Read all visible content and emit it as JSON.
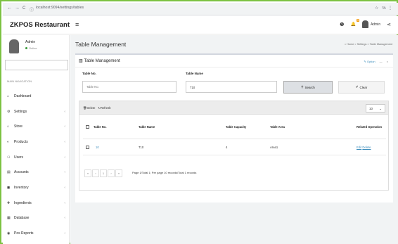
{
  "browser": {
    "back": "←",
    "forward": "→",
    "reload": "C",
    "info": "ⓘ",
    "url": "localhost:9094/settings/tables",
    "star": "☆",
    "ext": "℅",
    "menu": "⋮"
  },
  "header": {
    "brand": "ZKPOS Restaurant",
    "menu_toggle": "≡",
    "info_icon": "❶",
    "bell_icon": "🔔",
    "notification_count": "3",
    "user_label": "Admin",
    "share_icon": "⋖"
  },
  "sidebar": {
    "user_name": "Admin",
    "user_status": "Online",
    "search_placeholder": "",
    "section_label": "MAIN NAVIGATION",
    "items": [
      {
        "icon": "⌂",
        "label": "Dashboard",
        "chevron": ""
      },
      {
        "icon": "⚙",
        "label": "Settings",
        "chevron": "‹"
      },
      {
        "icon": "⌂",
        "label": "Store",
        "chevron": "‹"
      },
      {
        "icon": "◐",
        "label": "Products",
        "chevron": "‹"
      },
      {
        "icon": "⚇",
        "label": "Users",
        "chevron": "‹"
      },
      {
        "icon": "▤",
        "label": "Accounts",
        "chevron": "‹"
      },
      {
        "icon": "◼",
        "label": "Inventory",
        "chevron": "‹"
      },
      {
        "icon": "✚",
        "label": "Ingredients",
        "chevron": "‹"
      },
      {
        "icon": "▦",
        "label": "Database",
        "chevron": "‹"
      },
      {
        "icon": "◉",
        "label": "Pos Reports",
        "chevron": "‹"
      }
    ]
  },
  "content": {
    "page_title": "Table Management",
    "breadcrumb": [
      "Home",
      "Settings",
      "Table Management"
    ],
    "box_title": "Table Management",
    "box_tools": {
      "option": "✎ Option",
      "collapse": "—",
      "close": "×"
    },
    "form": {
      "table_no_label": "Table No.",
      "table_no_placeholder": "Table No.",
      "table_name_label": "Table Name",
      "table_name_value": "T10",
      "search_button": "Search",
      "clear_button": "Clear"
    },
    "grid": {
      "delete_label": "Delete",
      "refresh_label": "Refresh",
      "page_size": "10",
      "columns": [
        "Table No.",
        "Table Name",
        "Table Capacity",
        "Table Area",
        "Related Operation"
      ],
      "rows": [
        {
          "table_no": "10",
          "table_name": "T10",
          "capacity": "4",
          "area": "Area1",
          "edit": "Edit",
          "delete": "Delete"
        }
      ],
      "pager": {
        "first": "«",
        "prev": "‹",
        "page": "1",
        "next": "›",
        "last": "»",
        "info": "Page 1/Total 1; Per page 10 records/Total 1 records"
      }
    }
  }
}
